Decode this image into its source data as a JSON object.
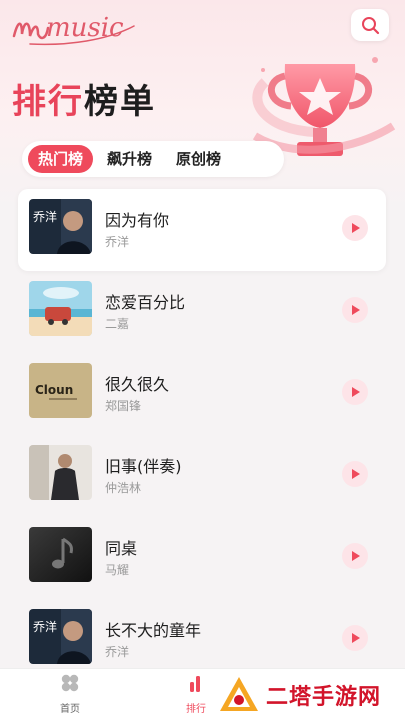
{
  "header": {
    "logo_text": "music",
    "title_part1": "排行",
    "title_part2": "榜单"
  },
  "tabs": [
    {
      "label": "热门榜",
      "active": true
    },
    {
      "label": "飙升榜",
      "active": false
    },
    {
      "label": "原创榜",
      "active": false
    }
  ],
  "songs": [
    {
      "title": "因为有你",
      "artist": "乔洋",
      "cover_text": "乔洋"
    },
    {
      "title": "恋爱百分比",
      "artist": "二嘉",
      "cover_text": ""
    },
    {
      "title": "很久很久",
      "artist": "郑国锋",
      "cover_text": "Cloun"
    },
    {
      "title": "旧事(伴奏)",
      "artist": "仲浩林",
      "cover_text": ""
    },
    {
      "title": "同桌",
      "artist": "马耀",
      "cover_text": ""
    },
    {
      "title": "长不大的童年",
      "artist": "乔洋",
      "cover_text": "乔洋"
    }
  ],
  "bottom_nav": {
    "home_label": "首页",
    "rank_label": "排行"
  },
  "watermark": {
    "text": "二塔手游网"
  },
  "colors": {
    "accent": "#ef4a5c",
    "background": "#f6f3f4"
  },
  "icons": {
    "search": "search-icon",
    "play": "play-icon",
    "home": "home-grid-icon",
    "rank": "bar-chart-icon"
  }
}
